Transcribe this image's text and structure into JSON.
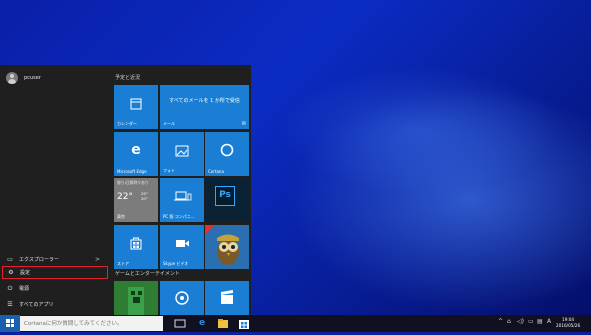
{
  "user": {
    "name": "pcuser"
  },
  "left_menu": [
    {
      "label": "エクスプローラー",
      "icon": "folder-icon",
      "chevron": ">"
    },
    {
      "label": "設定",
      "icon": "gear-icon"
    },
    {
      "label": "電源",
      "icon": "power-icon"
    },
    {
      "label": "すべてのアプリ",
      "icon": "list-icon"
    }
  ],
  "groups": [
    {
      "label": "予定と近況"
    },
    {
      "label": "ゲームとエンターテイメント"
    }
  ],
  "tiles": {
    "calendar": {
      "label": "カレンダー",
      "icon": "calendar-icon"
    },
    "mail": {
      "label": "メール",
      "message": "すべてのメールを 1 か所で受信",
      "icon": "mail-icon"
    },
    "edge": {
      "label": "Microsoft Edge",
      "icon": "edge-icon"
    },
    "photos": {
      "label": "フォト",
      "icon": "photo-icon"
    },
    "cortana": {
      "label": "Cortana",
      "icon": "cortana-circle-icon"
    },
    "weather": {
      "condition": "曇り/日照時々あり",
      "temp": "22°",
      "high": "25°",
      "low": "20°",
      "city": "東京"
    },
    "pc_manager": {
      "label": "PC 版 コンパニ...",
      "icon": "laptop-phone-icon"
    },
    "photoshop": {
      "label": "Ps",
      "icon": "photoshop-icon"
    },
    "store": {
      "label": "ストア",
      "icon": "store-bag-icon"
    },
    "skype": {
      "label": "Skype ビデオ",
      "icon": "video-camera-icon"
    },
    "game": {
      "icon": "owl-game-icon"
    },
    "minecraft": {
      "icon": "minecraft-icon"
    },
    "groove": {
      "icon": "groove-music-icon"
    },
    "movies": {
      "icon": "clapperboard-icon"
    }
  },
  "taskbar": {
    "search_placeholder": "Cortanaに何か質問してみてください。",
    "apps": [
      "task-view-icon",
      "edge-icon",
      "explorer-icon",
      "store-icon"
    ],
    "tray": {
      "up": "^",
      "ime": "A"
    },
    "clock": {
      "time": "19:04",
      "date": "2016/05/26"
    }
  },
  "colors": {
    "tile_blue": "#1a7fd4",
    "settings_highlight": "#e0202a",
    "menu_bg": "#1f1f1f"
  }
}
